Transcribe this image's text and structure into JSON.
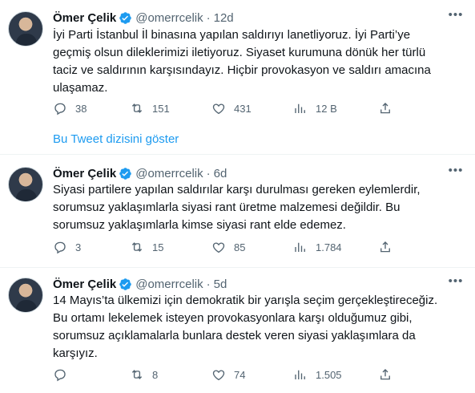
{
  "tweets": [
    {
      "name": "Ömer Çelik",
      "handle": "@omerrcelik",
      "dot": "·",
      "time": "12d",
      "text": "İyi Parti İstanbul İl binasına yapılan saldırıyı lanetliyoruz. İyi Parti’ye\ngeçmiş olsun dileklerimizi iletiyoruz. Siyaset kurumuna dönük her türlü\ntaciz ve saldırının karşısındayız. Hiçbir provokasyon ve saldırı amacına\nulaşamaz.",
      "replies": "38",
      "retweets": "151",
      "likes": "431",
      "views": "12 B"
    },
    {
      "name": "Ömer Çelik",
      "handle": "@omerrcelik",
      "dot": "·",
      "time": "6d",
      "text": "Siyasi partilere yapılan saldırılar karşı durulması gereken eylemlerdir,\nsorumsuz yaklaşımlarla siyasi rant üretme malzemesi değildir. Bu\nsorumsuz yaklaşımlarla kimse siyasi rant elde edemez.",
      "replies": "3",
      "retweets": "15",
      "likes": "85",
      "views": "1.784"
    },
    {
      "name": "Ömer Çelik",
      "handle": "@omerrcelik",
      "dot": "·",
      "time": "5d",
      "text": "14 Mayıs’ta ülkemizi için demokratik bir yarışla seçim gerçekleştireceğiz.\nBu ortamı lekelemek isteyen provokasyonlara karşı olduğumuz gibi,\nsorumsuz açıklamalarla bunlara destek veren siyasi yaklaşımlara da\nkarşıyız.",
      "replies": "",
      "retweets": "8",
      "likes": "74",
      "views": "1.505"
    }
  ],
  "show_thread_label": "Bu Tweet dizisini göster",
  "colors": {
    "accent": "#1d9bf0",
    "muted": "#536471",
    "text": "#0f1419"
  },
  "icons": [
    "verified-badge-icon",
    "more-icon",
    "reply-icon",
    "retweet-icon",
    "like-icon",
    "views-icon",
    "share-icon"
  ]
}
